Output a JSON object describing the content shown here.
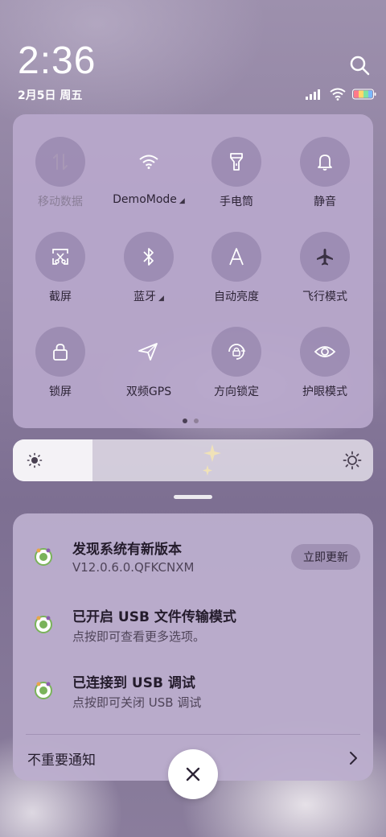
{
  "status": {
    "time": "2:36",
    "date": "2月5日 周五",
    "icons": [
      "signal-icon",
      "wifi-icon",
      "battery-icon"
    ]
  },
  "quick_settings": {
    "tiles": [
      {
        "label": "移动数据",
        "icon": "mobile-data-icon",
        "state": "disabled"
      },
      {
        "label": "DemoMode",
        "icon": "wifi-icon",
        "state": "on",
        "has_dropdown": true
      },
      {
        "label": "手电筒",
        "icon": "flashlight-icon",
        "state": "off"
      },
      {
        "label": "静音",
        "icon": "bell-icon",
        "state": "off"
      },
      {
        "label": "截屏",
        "icon": "screenshot-icon",
        "state": "off"
      },
      {
        "label": "蓝牙",
        "icon": "bluetooth-icon",
        "state": "off",
        "has_dropdown": true
      },
      {
        "label": "自动亮度",
        "icon": "auto-brightness-icon",
        "state": "off"
      },
      {
        "label": "飞行模式",
        "icon": "airplane-icon",
        "state": "off"
      },
      {
        "label": "锁屏",
        "icon": "lock-icon",
        "state": "off"
      },
      {
        "label": "双频GPS",
        "icon": "location-icon",
        "state": "on"
      },
      {
        "label": "方向锁定",
        "icon": "rotation-lock-icon",
        "state": "off"
      },
      {
        "label": "护眼模式",
        "icon": "eye-icon",
        "state": "off"
      }
    ],
    "page_count": 2,
    "active_page": 1
  },
  "brightness": {
    "level": 0.22
  },
  "notifications": [
    {
      "title": "发现系统有新版本",
      "subtitle": "V12.0.6.0.QFKCNXM",
      "action": "立即更新"
    },
    {
      "title": "已开启 USB 文件传输模式",
      "subtitle": "点按即可查看更多选项。"
    },
    {
      "title": "已连接到 USB 调试",
      "subtitle": "点按即可关闭 USB 调试"
    }
  ],
  "unimportant_label": "不重要通知",
  "colors": {
    "tile_bg": "#9686ac",
    "panel_bg": "#b8a8cc",
    "text_dark": "#2d2436"
  }
}
